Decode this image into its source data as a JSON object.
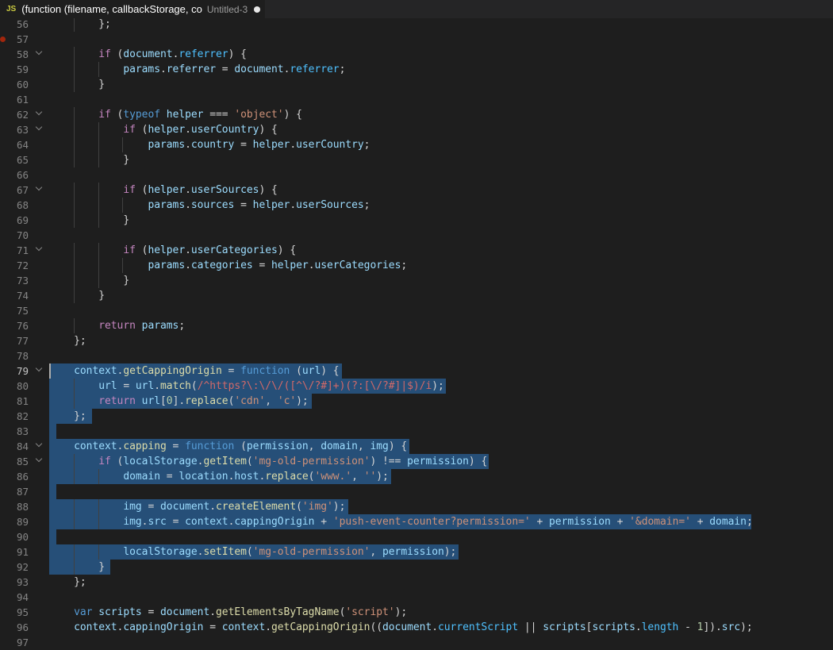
{
  "tab": {
    "icon": "JS",
    "title": "(function (filename, callbackStorage, co",
    "description": "Untitled-3",
    "dirty": true
  },
  "editor": {
    "breakpoint_line": 57,
    "active_line": 79,
    "lines": [
      {
        "n": 56,
        "fold": false,
        "tokens": [
          [
            "        };",
            "pun"
          ]
        ]
      },
      {
        "n": 57,
        "fold": false,
        "tokens": []
      },
      {
        "n": 58,
        "fold": true,
        "tokens": [
          [
            "        ",
            "pun"
          ],
          [
            "if",
            "kw"
          ],
          [
            " (",
            "pun"
          ],
          [
            "document",
            "var"
          ],
          [
            ".",
            "pun"
          ],
          [
            "referrer",
            "prop"
          ],
          [
            ") {",
            "pun"
          ]
        ]
      },
      {
        "n": 59,
        "fold": false,
        "tokens": [
          [
            "            ",
            "pun"
          ],
          [
            "params",
            "var"
          ],
          [
            ".",
            "pun"
          ],
          [
            "referrer",
            "var"
          ],
          [
            " = ",
            "op"
          ],
          [
            "document",
            "var"
          ],
          [
            ".",
            "pun"
          ],
          [
            "referrer",
            "prop"
          ],
          [
            ";",
            "pun"
          ]
        ]
      },
      {
        "n": 60,
        "fold": false,
        "tokens": [
          [
            "        }",
            "pun"
          ]
        ]
      },
      {
        "n": 61,
        "fold": false,
        "tokens": []
      },
      {
        "n": 62,
        "fold": true,
        "tokens": [
          [
            "        ",
            "pun"
          ],
          [
            "if",
            "kw"
          ],
          [
            " (",
            "pun"
          ],
          [
            "typeof",
            "dec"
          ],
          [
            " ",
            "pun"
          ],
          [
            "helper",
            "var"
          ],
          [
            " === ",
            "op"
          ],
          [
            "'object'",
            "str"
          ],
          [
            ") {",
            "pun"
          ]
        ]
      },
      {
        "n": 63,
        "fold": true,
        "tokens": [
          [
            "            ",
            "pun"
          ],
          [
            "if",
            "kw"
          ],
          [
            " (",
            "pun"
          ],
          [
            "helper",
            "var"
          ],
          [
            ".",
            "pun"
          ],
          [
            "userCountry",
            "var"
          ],
          [
            ") {",
            "pun"
          ]
        ]
      },
      {
        "n": 64,
        "fold": false,
        "tokens": [
          [
            "                ",
            "pun"
          ],
          [
            "params",
            "var"
          ],
          [
            ".",
            "pun"
          ],
          [
            "country",
            "var"
          ],
          [
            " = ",
            "op"
          ],
          [
            "helper",
            "var"
          ],
          [
            ".",
            "pun"
          ],
          [
            "userCountry",
            "var"
          ],
          [
            ";",
            "pun"
          ]
        ]
      },
      {
        "n": 65,
        "fold": false,
        "tokens": [
          [
            "            }",
            "pun"
          ]
        ]
      },
      {
        "n": 66,
        "fold": false,
        "tokens": []
      },
      {
        "n": 67,
        "fold": true,
        "tokens": [
          [
            "            ",
            "pun"
          ],
          [
            "if",
            "kw"
          ],
          [
            " (",
            "pun"
          ],
          [
            "helper",
            "var"
          ],
          [
            ".",
            "pun"
          ],
          [
            "userSources",
            "var"
          ],
          [
            ") {",
            "pun"
          ]
        ]
      },
      {
        "n": 68,
        "fold": false,
        "tokens": [
          [
            "                ",
            "pun"
          ],
          [
            "params",
            "var"
          ],
          [
            ".",
            "pun"
          ],
          [
            "sources",
            "var"
          ],
          [
            " = ",
            "op"
          ],
          [
            "helper",
            "var"
          ],
          [
            ".",
            "pun"
          ],
          [
            "userSources",
            "var"
          ],
          [
            ";",
            "pun"
          ]
        ]
      },
      {
        "n": 69,
        "fold": false,
        "tokens": [
          [
            "            }",
            "pun"
          ]
        ]
      },
      {
        "n": 70,
        "fold": false,
        "tokens": []
      },
      {
        "n": 71,
        "fold": true,
        "tokens": [
          [
            "            ",
            "pun"
          ],
          [
            "if",
            "kw"
          ],
          [
            " (",
            "pun"
          ],
          [
            "helper",
            "var"
          ],
          [
            ".",
            "pun"
          ],
          [
            "userCategories",
            "var"
          ],
          [
            ") {",
            "pun"
          ]
        ]
      },
      {
        "n": 72,
        "fold": false,
        "tokens": [
          [
            "                ",
            "pun"
          ],
          [
            "params",
            "var"
          ],
          [
            ".",
            "pun"
          ],
          [
            "categories",
            "var"
          ],
          [
            " = ",
            "op"
          ],
          [
            "helper",
            "var"
          ],
          [
            ".",
            "pun"
          ],
          [
            "userCategories",
            "var"
          ],
          [
            ";",
            "pun"
          ]
        ]
      },
      {
        "n": 73,
        "fold": false,
        "tokens": [
          [
            "            }",
            "pun"
          ]
        ]
      },
      {
        "n": 74,
        "fold": false,
        "tokens": [
          [
            "        }",
            "pun"
          ]
        ]
      },
      {
        "n": 75,
        "fold": false,
        "tokens": []
      },
      {
        "n": 76,
        "fold": false,
        "tokens": [
          [
            "        ",
            "pun"
          ],
          [
            "return",
            "kw"
          ],
          [
            " ",
            "pun"
          ],
          [
            "params",
            "var"
          ],
          [
            ";",
            "pun"
          ]
        ]
      },
      {
        "n": 77,
        "fold": false,
        "tokens": [
          [
            "    };",
            "pun"
          ]
        ]
      },
      {
        "n": 78,
        "fold": false,
        "tokens": []
      },
      {
        "n": 79,
        "fold": true,
        "tokens": [
          [
            "    ",
            "pun"
          ],
          [
            "context",
            "var"
          ],
          [
            ".",
            "pun"
          ],
          [
            "getCappingOrigin",
            "fn"
          ],
          [
            " = ",
            "op"
          ],
          [
            "function",
            "dec"
          ],
          [
            " (",
            "pun"
          ],
          [
            "url",
            "var"
          ],
          [
            ") {",
            "pun"
          ]
        ]
      },
      {
        "n": 80,
        "fold": false,
        "tokens": [
          [
            "        ",
            "pun"
          ],
          [
            "url",
            "var"
          ],
          [
            " = ",
            "op"
          ],
          [
            "url",
            "var"
          ],
          [
            ".",
            "pun"
          ],
          [
            "match",
            "fn"
          ],
          [
            "(",
            "pun"
          ],
          [
            "/^https?\\:\\/\\/([^\\/?#]+)(?:[\\/?#]|$)/i",
            "re"
          ],
          [
            ");",
            "pun"
          ]
        ]
      },
      {
        "n": 81,
        "fold": false,
        "tokens": [
          [
            "        ",
            "pun"
          ],
          [
            "return",
            "kw"
          ],
          [
            " ",
            "pun"
          ],
          [
            "url",
            "var"
          ],
          [
            "[",
            "pun"
          ],
          [
            "0",
            "num"
          ],
          [
            "].",
            "pun"
          ],
          [
            "replace",
            "fn"
          ],
          [
            "(",
            "pun"
          ],
          [
            "'cdn'",
            "str"
          ],
          [
            ", ",
            "pun"
          ],
          [
            "'c'",
            "str"
          ],
          [
            ");",
            "pun"
          ]
        ]
      },
      {
        "n": 82,
        "fold": false,
        "tokens": [
          [
            "    };",
            "pun"
          ]
        ]
      },
      {
        "n": 83,
        "fold": false,
        "tokens": []
      },
      {
        "n": 84,
        "fold": true,
        "tokens": [
          [
            "    ",
            "pun"
          ],
          [
            "context",
            "var"
          ],
          [
            ".",
            "pun"
          ],
          [
            "capping",
            "fn"
          ],
          [
            " = ",
            "op"
          ],
          [
            "function",
            "dec"
          ],
          [
            " (",
            "pun"
          ],
          [
            "permission",
            "var"
          ],
          [
            ", ",
            "pun"
          ],
          [
            "domain",
            "var"
          ],
          [
            ", ",
            "pun"
          ],
          [
            "img",
            "var"
          ],
          [
            ") {",
            "pun"
          ]
        ]
      },
      {
        "n": 85,
        "fold": true,
        "tokens": [
          [
            "        ",
            "pun"
          ],
          [
            "if",
            "kw"
          ],
          [
            " (",
            "pun"
          ],
          [
            "localStorage",
            "var"
          ],
          [
            ".",
            "pun"
          ],
          [
            "getItem",
            "fn"
          ],
          [
            "(",
            "pun"
          ],
          [
            "'mg-old-permission'",
            "str"
          ],
          [
            ") !== ",
            "op"
          ],
          [
            "permission",
            "var"
          ],
          [
            ") {",
            "pun"
          ]
        ]
      },
      {
        "n": 86,
        "fold": false,
        "tokens": [
          [
            "            ",
            "pun"
          ],
          [
            "domain",
            "var"
          ],
          [
            " = ",
            "op"
          ],
          [
            "location",
            "var"
          ],
          [
            ".",
            "pun"
          ],
          [
            "host",
            "var"
          ],
          [
            ".",
            "pun"
          ],
          [
            "replace",
            "fn"
          ],
          [
            "(",
            "pun"
          ],
          [
            "'www.'",
            "str"
          ],
          [
            ", ",
            "pun"
          ],
          [
            "''",
            "str"
          ],
          [
            ");",
            "pun"
          ]
        ]
      },
      {
        "n": 87,
        "fold": false,
        "tokens": []
      },
      {
        "n": 88,
        "fold": false,
        "tokens": [
          [
            "            ",
            "pun"
          ],
          [
            "img",
            "var"
          ],
          [
            " = ",
            "op"
          ],
          [
            "document",
            "var"
          ],
          [
            ".",
            "pun"
          ],
          [
            "createElement",
            "fn"
          ],
          [
            "(",
            "pun"
          ],
          [
            "'img'",
            "str"
          ],
          [
            ");",
            "pun"
          ]
        ]
      },
      {
        "n": 89,
        "fold": false,
        "tokens": [
          [
            "            ",
            "pun"
          ],
          [
            "img",
            "var"
          ],
          [
            ".",
            "pun"
          ],
          [
            "src",
            "var"
          ],
          [
            " = ",
            "op"
          ],
          [
            "context",
            "var"
          ],
          [
            ".",
            "pun"
          ],
          [
            "cappingOrigin",
            "var"
          ],
          [
            " + ",
            "op"
          ],
          [
            "'push-event-counter?permission='",
            "str"
          ],
          [
            " + ",
            "op"
          ],
          [
            "permission",
            "var"
          ],
          [
            " + ",
            "op"
          ],
          [
            "'&domain='",
            "str"
          ],
          [
            " + ",
            "op"
          ],
          [
            "domain",
            "var"
          ],
          [
            ";",
            "pun"
          ]
        ]
      },
      {
        "n": 90,
        "fold": false,
        "tokens": []
      },
      {
        "n": 91,
        "fold": false,
        "tokens": [
          [
            "            ",
            "pun"
          ],
          [
            "localStorage",
            "var"
          ],
          [
            ".",
            "pun"
          ],
          [
            "setItem",
            "fn"
          ],
          [
            "(",
            "pun"
          ],
          [
            "'mg-old-permission'",
            "str"
          ],
          [
            ", ",
            "pun"
          ],
          [
            "permission",
            "var"
          ],
          [
            ");",
            "pun"
          ]
        ]
      },
      {
        "n": 92,
        "fold": false,
        "tokens": [
          [
            "        }",
            "pun"
          ]
        ]
      },
      {
        "n": 93,
        "fold": false,
        "tokens": [
          [
            "    };",
            "pun"
          ]
        ]
      },
      {
        "n": 94,
        "fold": false,
        "tokens": []
      },
      {
        "n": 95,
        "fold": false,
        "tokens": [
          [
            "    ",
            "pun"
          ],
          [
            "var",
            "dec"
          ],
          [
            " ",
            "pun"
          ],
          [
            "scripts",
            "var"
          ],
          [
            " = ",
            "op"
          ],
          [
            "document",
            "var"
          ],
          [
            ".",
            "pun"
          ],
          [
            "getElementsByTagName",
            "fn"
          ],
          [
            "(",
            "pun"
          ],
          [
            "'script'",
            "str"
          ],
          [
            ");",
            "pun"
          ]
        ]
      },
      {
        "n": 96,
        "fold": false,
        "tokens": [
          [
            "    ",
            "pun"
          ],
          [
            "context",
            "var"
          ],
          [
            ".",
            "pun"
          ],
          [
            "cappingOrigin",
            "var"
          ],
          [
            " = ",
            "op"
          ],
          [
            "context",
            "var"
          ],
          [
            ".",
            "pun"
          ],
          [
            "getCappingOrigin",
            "fn"
          ],
          [
            "((",
            "pun"
          ],
          [
            "document",
            "var"
          ],
          [
            ".",
            "pun"
          ],
          [
            "currentScript",
            "prop"
          ],
          [
            " || ",
            "op"
          ],
          [
            "scripts",
            "var"
          ],
          [
            "[",
            "pun"
          ],
          [
            "scripts",
            "var"
          ],
          [
            ".",
            "pun"
          ],
          [
            "length",
            "prop"
          ],
          [
            " - ",
            "op"
          ],
          [
            "1",
            "num"
          ],
          [
            "]).",
            "pun"
          ],
          [
            "src",
            "var"
          ],
          [
            ");",
            "pun"
          ]
        ]
      },
      {
        "n": 97,
        "fold": false,
        "tokens": []
      }
    ]
  },
  "colors": {
    "background": "#1e1e1e",
    "selection": "#264f78",
    "keyword": "#c586c0",
    "string": "#ce9178",
    "function": "#dcdcaa",
    "variable": "#9cdcfe",
    "regex": "#d16969"
  }
}
